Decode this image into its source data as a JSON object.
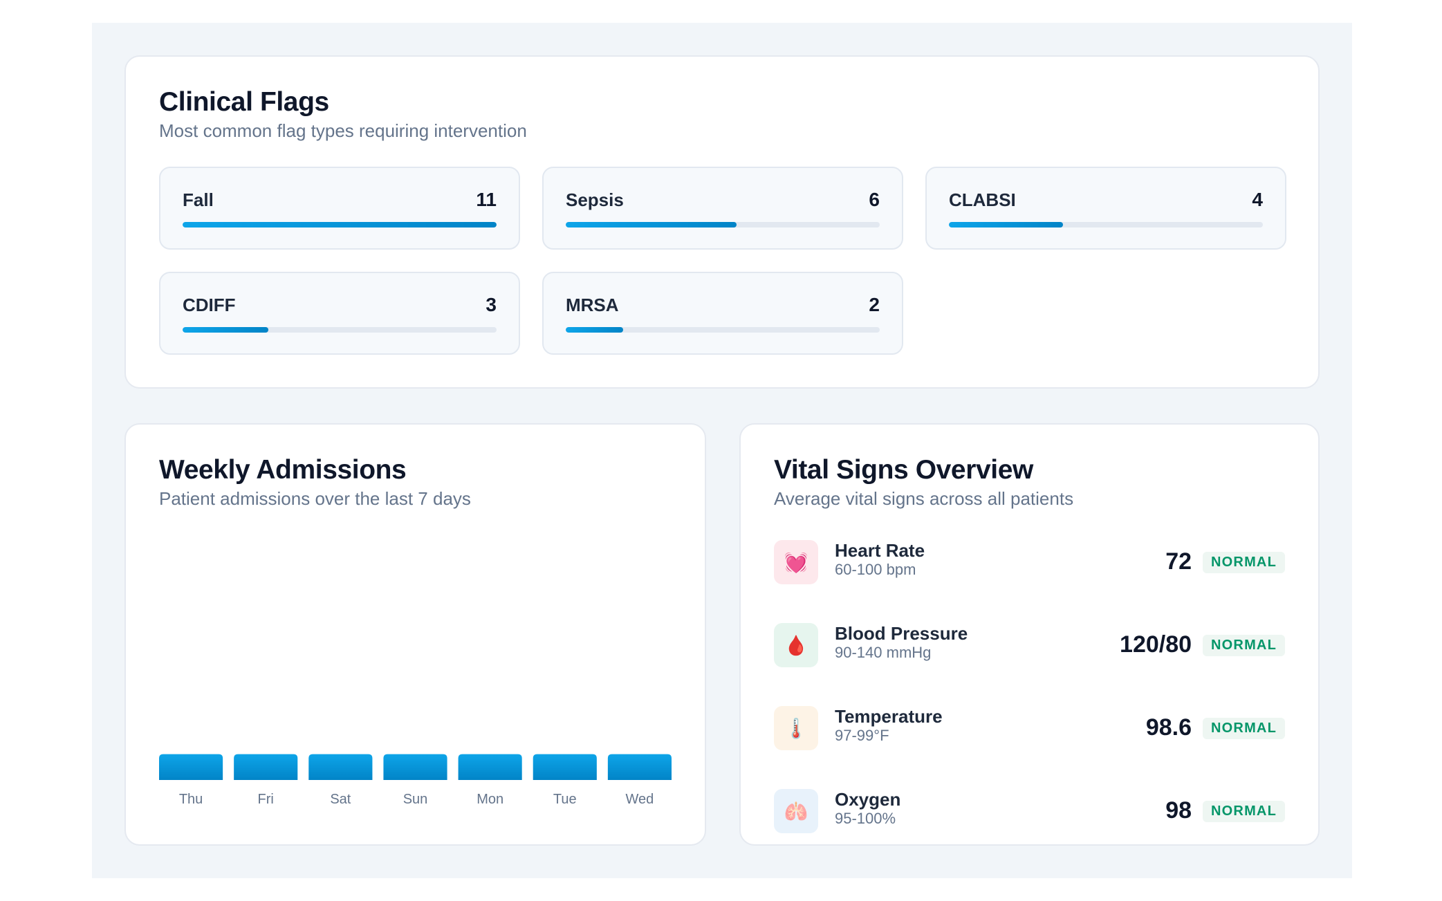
{
  "clinical_flags": {
    "title": "Clinical Flags",
    "subtitle": "Most common flag types requiring intervention",
    "items": [
      {
        "label": "Fall",
        "count": "11",
        "fraction": 1.0
      },
      {
        "label": "Sepsis",
        "count": "6",
        "fraction": 0.545
      },
      {
        "label": "CLABSI",
        "count": "4",
        "fraction": 0.364
      },
      {
        "label": "CDIFF",
        "count": "3",
        "fraction": 0.273
      },
      {
        "label": "MRSA",
        "count": "2",
        "fraction": 0.182
      }
    ],
    "bar_color": "#0ea5e9"
  },
  "weekly_admissions": {
    "title": "Weekly Admissions",
    "subtitle": "Patient admissions over the last 7 days"
  },
  "chart_data": {
    "type": "bar",
    "categories": [
      "Thu",
      "Fri",
      "Sat",
      "Sun",
      "Mon",
      "Tue",
      "Wed"
    ],
    "values": [
      1,
      1,
      1,
      1,
      1,
      1,
      1
    ],
    "ylim": [
      0,
      10
    ],
    "grid": false,
    "bar_color": "#0ea5e9"
  },
  "vital_signs": {
    "title": "Vital Signs Overview",
    "subtitle": "Average vital signs across all patients",
    "items": [
      {
        "name": "Heart Rate",
        "range": "60-100 bpm",
        "value": "72",
        "status": "NORMAL",
        "icon": "💓",
        "icon_name": "heart-icon",
        "icon_bg": "#fde8ec"
      },
      {
        "name": "Blood Pressure",
        "range": "90-140 mmHg",
        "value": "120/80",
        "status": "NORMAL",
        "icon": "🩸",
        "icon_name": "blood-drop-icon",
        "icon_bg": "#e6f5ee"
      },
      {
        "name": "Temperature",
        "range": "97-99°F",
        "value": "98.6",
        "status": "NORMAL",
        "icon": "🌡️",
        "icon_name": "thermometer-icon",
        "icon_bg": "#fdf3e6"
      },
      {
        "name": "Oxygen",
        "range": "95-100%",
        "value": "98",
        "status": "NORMAL",
        "icon": "🫁",
        "icon_name": "lungs-icon",
        "icon_bg": "#e8f2fb"
      }
    ],
    "status_color": "#059669"
  }
}
